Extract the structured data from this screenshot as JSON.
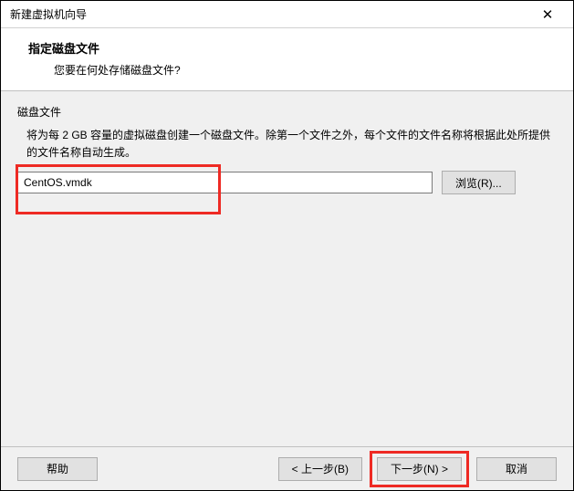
{
  "titlebar": {
    "title": "新建虚拟机向导"
  },
  "header": {
    "title": "指定磁盘文件",
    "subtitle": "您要在何处存储磁盘文件?"
  },
  "content": {
    "section_label": "磁盘文件",
    "description": "将为每 2 GB 容量的虚拟磁盘创建一个磁盘文件。除第一个文件之外，每个文件的文件名称将根据此处所提供的文件名称自动生成。",
    "file_value": "CentOS.vmdk",
    "browse_label": "浏览(R)..."
  },
  "footer": {
    "help_label": "帮助",
    "back_label": "< 上一步(B)",
    "next_label": "下一步(N) >",
    "cancel_label": "取消"
  }
}
